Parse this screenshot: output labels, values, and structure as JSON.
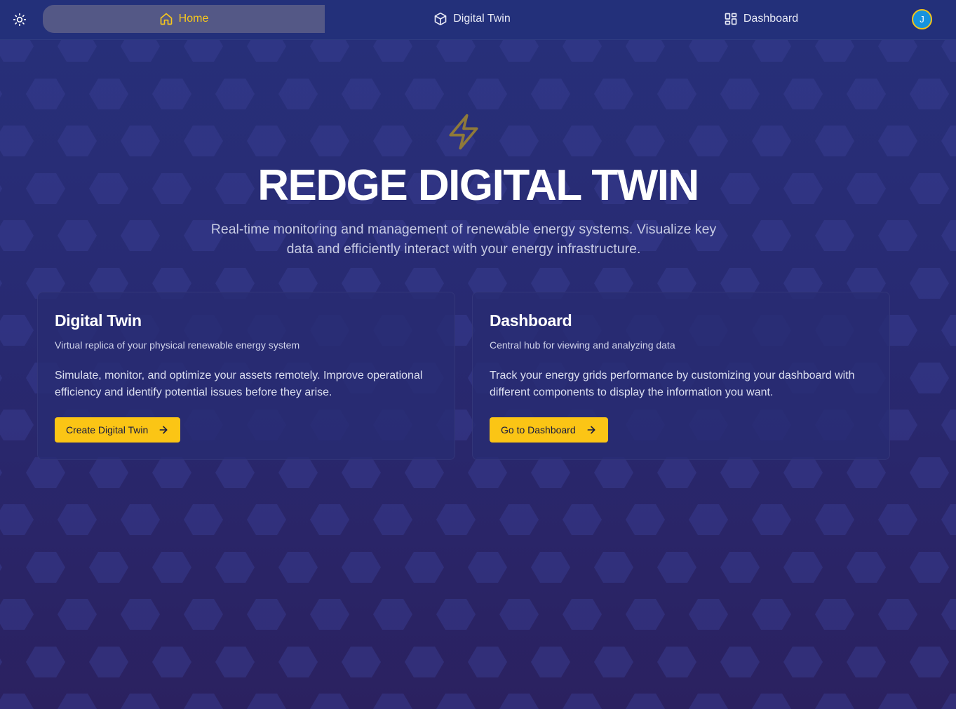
{
  "nav": {
    "tabs": [
      {
        "label": "Home",
        "icon": "home-icon",
        "active": true
      },
      {
        "label": "Digital Twin",
        "icon": "cube-icon",
        "active": false
      },
      {
        "label": "Dashboard",
        "icon": "grid-icon",
        "active": false
      }
    ],
    "theme_icon": "sun-icon",
    "avatar_initial": "J"
  },
  "hero": {
    "icon": "lightning-bolt-icon",
    "title": "REDGE DIGITAL TWIN",
    "subtitle": "Real-time monitoring and management of renewable energy systems. Visualize key data and efficiently interact with your energy infrastructure."
  },
  "cards": [
    {
      "title": "Digital Twin",
      "subtitle": "Virtual replica of your physical renewable energy system",
      "body": "Simulate, monitor, and optimize your assets remotely. Improve operational efficiency and identify potential issues before they arise.",
      "button": "Create Digital Twin"
    },
    {
      "title": "Dashboard",
      "subtitle": "Central hub for viewing and analyzing data",
      "body": "Track your energy grids performance by customizing your dashboard with different components to display the information you want.",
      "button": "Go to Dashboard"
    }
  ],
  "colors": {
    "accent": "#fbc515",
    "background": "#282a72",
    "navbar": "#23307a",
    "active_tab": "#545886"
  }
}
